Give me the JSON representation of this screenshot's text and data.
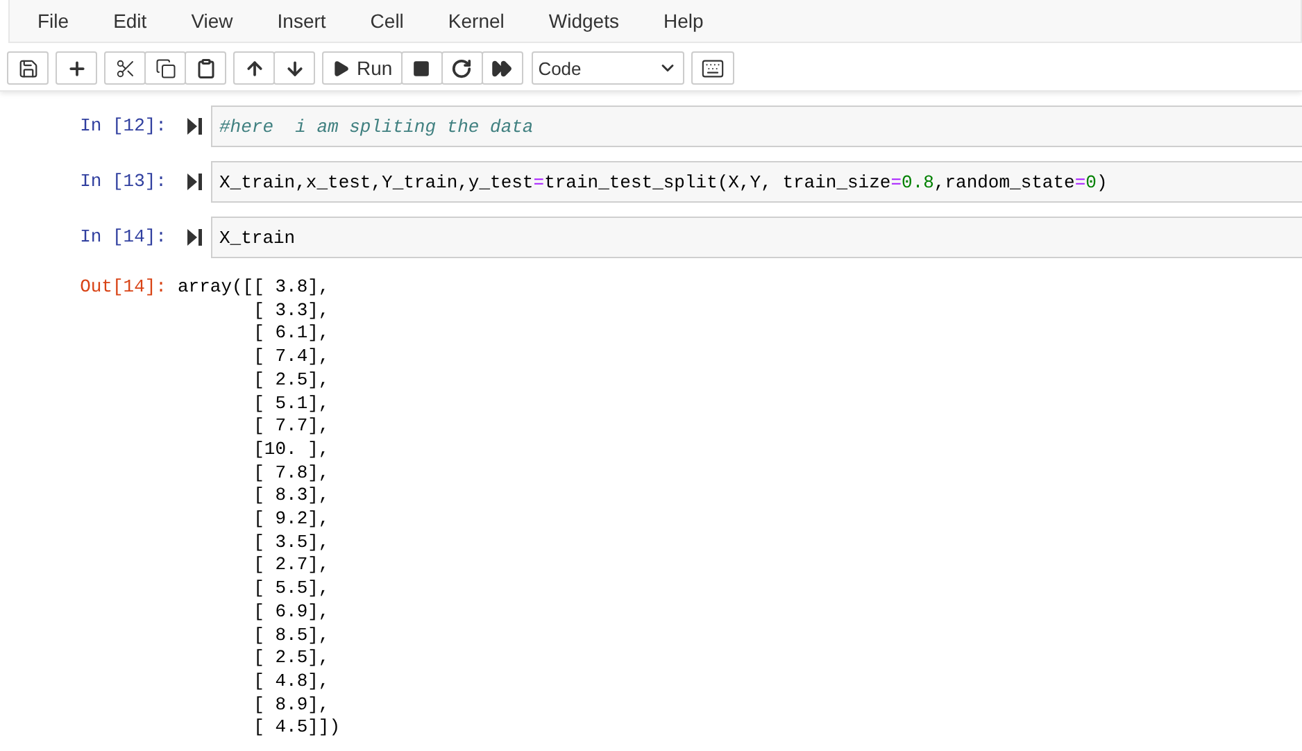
{
  "menu": [
    "File",
    "Edit",
    "View",
    "Insert",
    "Cell",
    "Kernel",
    "Widgets",
    "Help"
  ],
  "toolbar": {
    "run_label": "Run",
    "cell_type": "Code"
  },
  "cells": [
    {
      "prompt": "In [12]:",
      "tokens": [
        {
          "kind": "comment",
          "text": "#here  i am spliting the data"
        }
      ]
    },
    {
      "prompt": "In [13]:",
      "tokens": [
        {
          "kind": "plain",
          "text": "X_train,x_test,Y_train,y_test"
        },
        {
          "kind": "operator",
          "text": "="
        },
        {
          "kind": "plain",
          "text": "train_test_split(X,Y, train_size"
        },
        {
          "kind": "operator",
          "text": "="
        },
        {
          "kind": "number",
          "text": "0.8"
        },
        {
          "kind": "plain",
          "text": ",random_state"
        },
        {
          "kind": "operator",
          "text": "="
        },
        {
          "kind": "number",
          "text": "0"
        },
        {
          "kind": "plain",
          "text": ")"
        }
      ]
    },
    {
      "prompt": "In [14]:",
      "tokens": [
        {
          "kind": "plain",
          "text": "X_train"
        }
      ],
      "output": {
        "prompt": "Out[14]:",
        "lines": [
          "array([[ 3.8],",
          "       [ 3.3],",
          "       [ 6.1],",
          "       [ 7.4],",
          "       [ 2.5],",
          "       [ 5.1],",
          "       [ 7.7],",
          "       [10. ],",
          "       [ 7.8],",
          "       [ 8.3],",
          "       [ 9.2],",
          "       [ 3.5],",
          "       [ 2.7],",
          "       [ 5.5],",
          "       [ 6.9],",
          "       [ 8.5],",
          "       [ 2.5],",
          "       [ 4.8],",
          "       [ 8.9],",
          "       [ 4.5]])"
        ]
      }
    }
  ]
}
